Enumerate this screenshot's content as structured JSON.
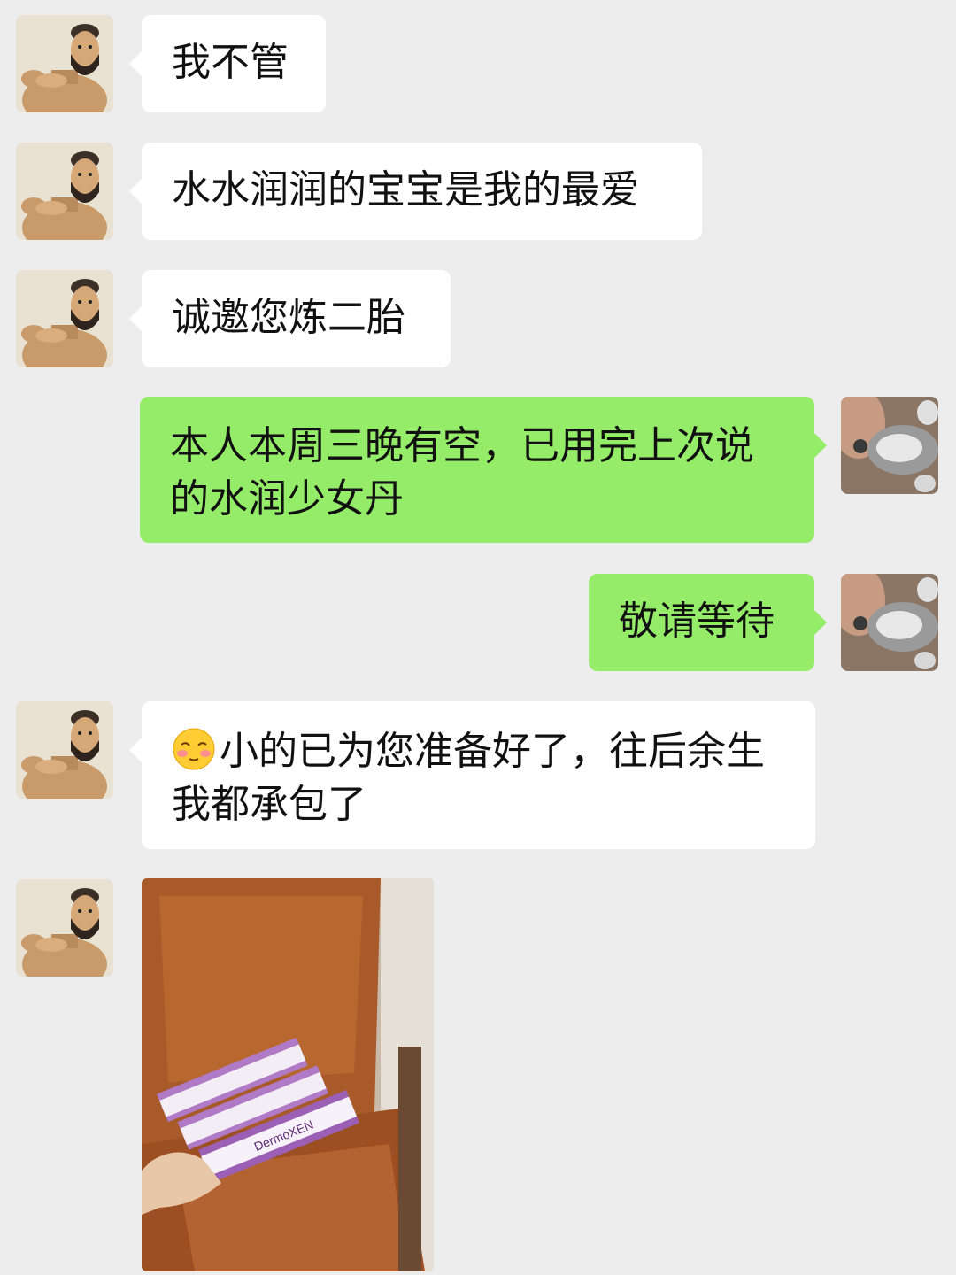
{
  "messages": [
    {
      "side": "in",
      "text": "我不管"
    },
    {
      "side": "in",
      "text": "水水润润的宝宝是我的最爱"
    },
    {
      "side": "in",
      "text": "诚邀您炼二胎"
    },
    {
      "side": "out",
      "text_line1": "本人本周三晚有空，已用完上次说",
      "text_line2": "的水润少女丹"
    },
    {
      "side": "out",
      "text": "敬请等待"
    },
    {
      "side": "in",
      "text_line1": "小的已为您准备好了，往后余生",
      "text_line2": "我都承包了",
      "emoji": "blushing-face-emoji"
    },
    {
      "side": "in",
      "type": "image",
      "photo_brand_text": "DermoXEN"
    }
  ],
  "colors": {
    "background": "#ededed",
    "incoming_bubble": "#ffffff",
    "outgoing_bubble": "#95ec69"
  },
  "icons": {
    "contact_avatar": "muscular-bearded-cartoon-avatar",
    "self_avatar": "cat-photo-avatar"
  }
}
